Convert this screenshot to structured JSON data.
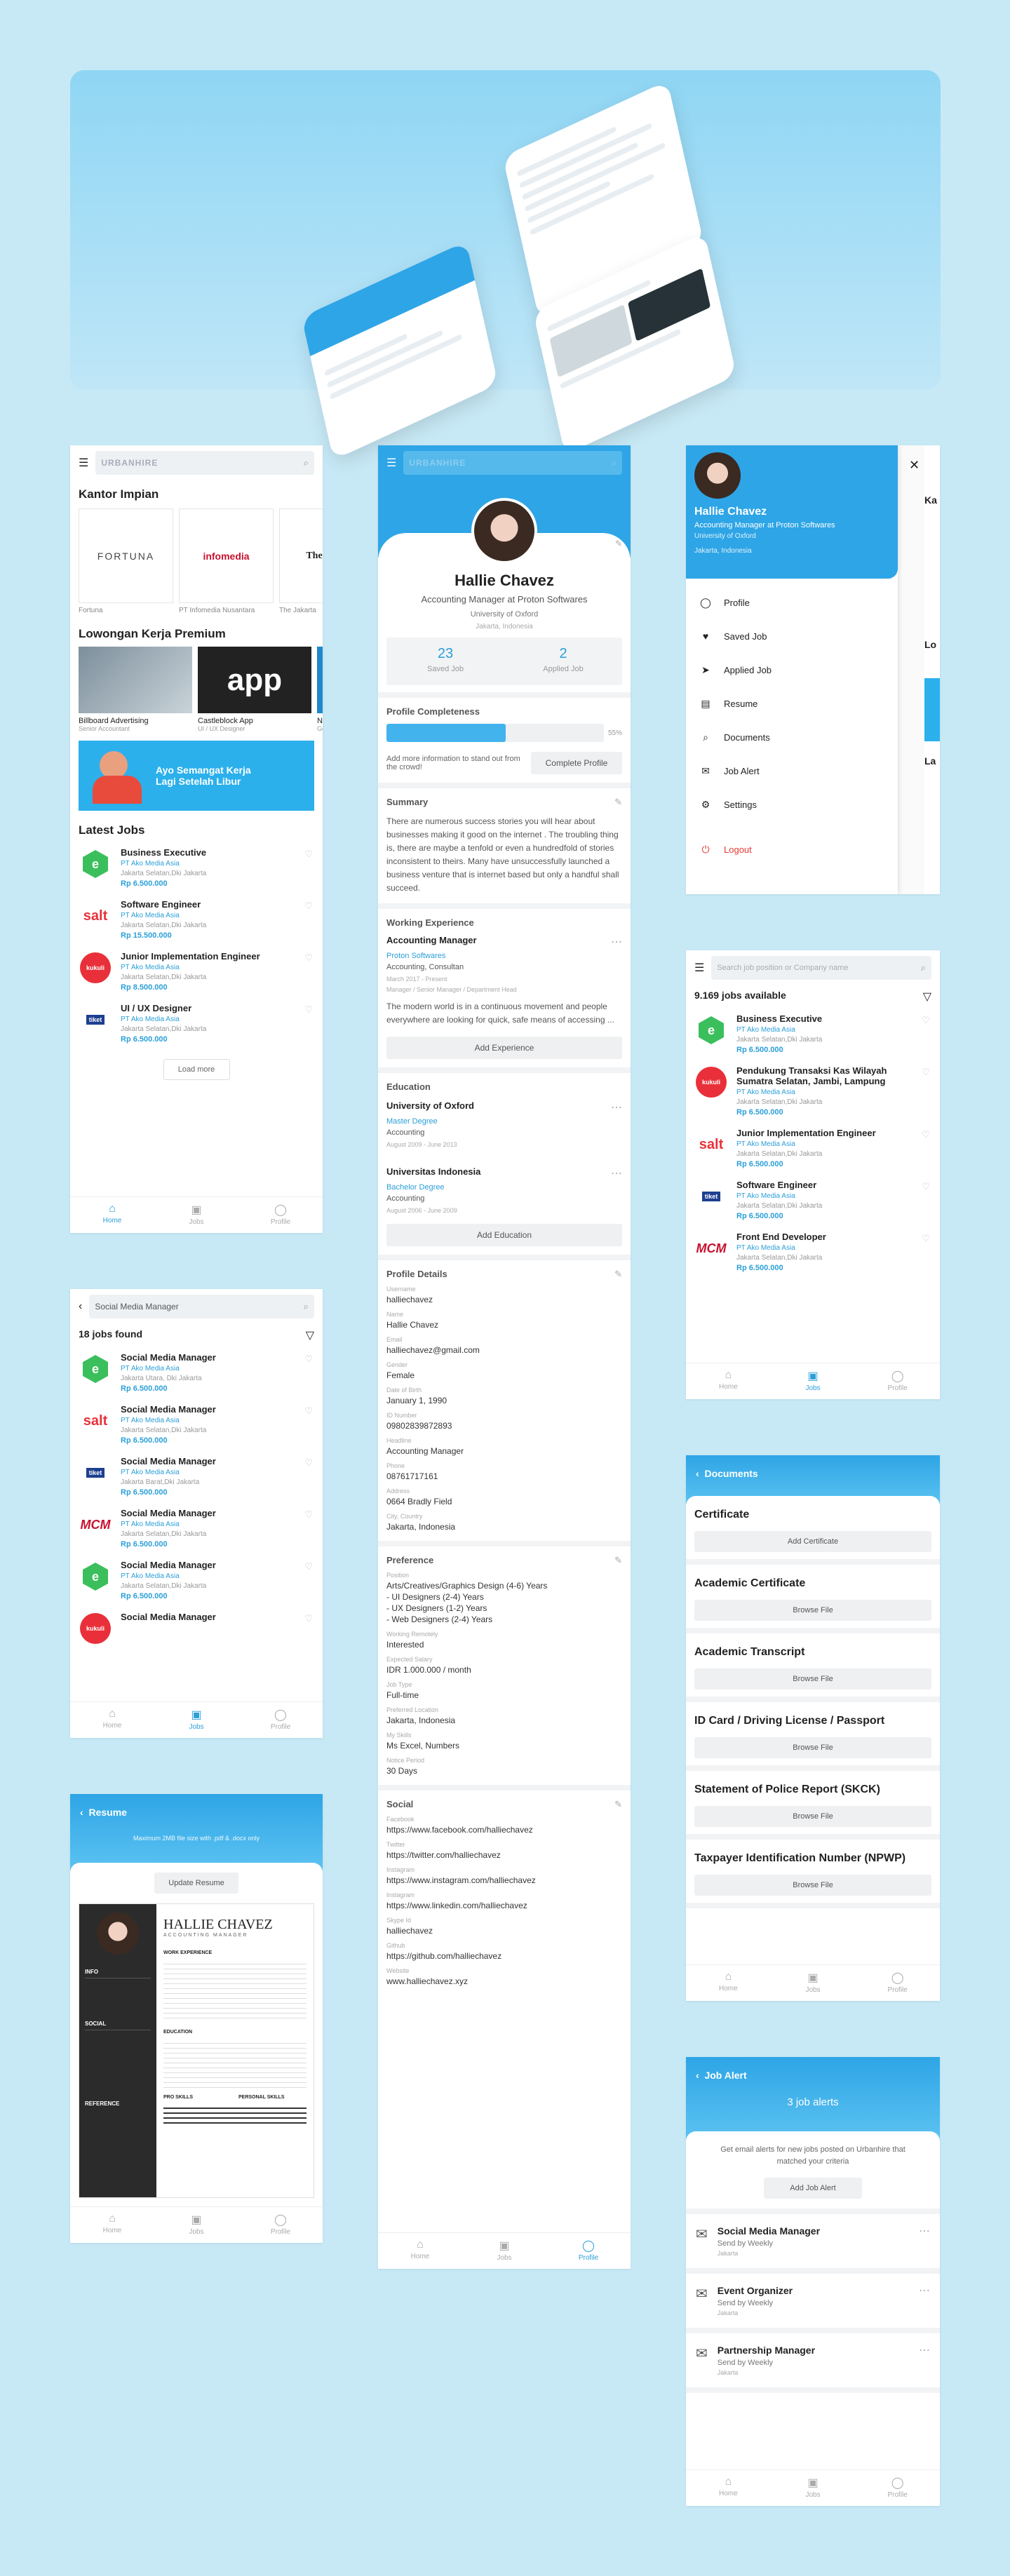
{
  "brand": "URBANHIRE",
  "nav": {
    "home": "Home",
    "jobs": "Jobs",
    "profile": "Profile"
  },
  "home": {
    "section_companies": "Kantor Impian",
    "companies": [
      {
        "name": "Fortuna",
        "logo": "FORTUNA"
      },
      {
        "name": "PT Infomedia Nusantara",
        "logo": "infomedia"
      },
      {
        "name": "The Jakarta",
        "logo": "TheJakar"
      }
    ],
    "section_premium": "Lowongan Kerja Premium",
    "premium": [
      {
        "title": "Billboard Advertising",
        "role": "Senior Accountant"
      },
      {
        "title": "Castleblock App",
        "role": "UI / UX Designer"
      },
      {
        "title": "Na",
        "role": "Ge"
      }
    ],
    "banner_line1": "Ayo Semangat Kerja",
    "banner_line2": "Lagi Setelah Libur",
    "section_latest": "Latest Jobs",
    "jobs": [
      {
        "title": "Business Executive",
        "company": "PT Ako Media Asia",
        "location": "Jakarta Selatan,Dki Jakarta",
        "salary": "Rp 6.500.000",
        "logo": "e",
        "color": "#3bbf5c"
      },
      {
        "title": "Software Engineer",
        "company": "PT Ako Media Asia",
        "location": "Jakarta Selatan,Dki Jakarta",
        "salary": "Rp 15.500.000",
        "logo": "salt",
        "color": "#e9303a"
      },
      {
        "title": "Junior Implementation Engineer",
        "company": "PT Ako Media Asia",
        "location": "Jakarta Selatan,Dki Jakarta",
        "salary": "Rp 8.500.000",
        "logo": "kukuli",
        "color": "#e9303a"
      },
      {
        "title": "UI / UX Designer",
        "company": "PT Ako Media Asia",
        "location": "Jakarta Selatan,Dki Jakarta",
        "salary": "Rp 6.500.000",
        "logo": "tiket",
        "color": "#1d3f8f"
      }
    ],
    "load_more": "Load more"
  },
  "profile": {
    "name": "Hallie Chavez",
    "headline": "Accounting Manager at Proton Softwares",
    "school": "University of Oxford",
    "city": "Jakarta, Indonesia",
    "saved_count": "23",
    "saved_label": "Saved Job",
    "applied_count": "2",
    "applied_label": "Applied Job",
    "completeness_title": "Profile Completeness",
    "completeness_pct": "55%",
    "completeness_value": 55,
    "completeness_hint": "Add more information to stand out from the crowd!",
    "complete_btn": "Complete Profile",
    "summary_title": "Summary",
    "summary_text": "There are numerous success stories you will hear about businesses making it good on the internet . The troubling thing is, there are maybe a tenfold or even a hundredfold of stories inconsistent to theirs. Many have unsuccessfully launched a business venture that is internet based but only a handful shall succeed.",
    "work_title": "Working Experience",
    "work": {
      "role": "Accounting Manager",
      "company": "Proton Softwares",
      "type": "Accounting, Consultan",
      "period": "March 2017 - Present",
      "tags": "Manager / Senior Manager / Department Head",
      "desc": "The modern world is in a continuous movement and people everywhere are looking for quick, safe means of accessing ..."
    },
    "add_experience": "Add Experience",
    "edu_title": "Education",
    "edu": [
      {
        "school": "University of Oxford",
        "degree": "Master Degree",
        "field": "Accounting",
        "period": "August 2009 - June 2013"
      },
      {
        "school": "Universitas Indonesia",
        "degree": "Bachelor Degree",
        "field": "Accounting",
        "period": "August 2006 - June 2009"
      }
    ],
    "add_education": "Add Education",
    "details_title": "Profile Details",
    "details": [
      {
        "k": "Username",
        "v": "halliechavez"
      },
      {
        "k": "Name",
        "v": "Hallie Chavez"
      },
      {
        "k": "Email",
        "v": "halliechavez@gmail.com"
      },
      {
        "k": "Gender",
        "v": "Female"
      },
      {
        "k": "Date of Birth",
        "v": "January 1, 1990"
      },
      {
        "k": "ID Number",
        "v": "09802839872893"
      },
      {
        "k": "Headline",
        "v": "Accounting Manager"
      },
      {
        "k": "Phone",
        "v": "08761717161"
      },
      {
        "k": "Address",
        "v": "0664 Bradly Field"
      },
      {
        "k": "City, Country",
        "v": "Jakarta, Indonesia"
      }
    ],
    "pref_title": "Preference",
    "pref": [
      {
        "k": "Position",
        "v": "Arts/Creatives/Graphics Design (4-6) Years\n- UI Designers (2-4) Years\n- UX Designers (1-2) Years\n- Web Designers (2-4) Years"
      },
      {
        "k": "Working Remotely",
        "v": "Interested"
      },
      {
        "k": "Expected Salary",
        "v": "IDR 1.000.000 / month"
      },
      {
        "k": "Job Type",
        "v": "Full-time"
      },
      {
        "k": "Preferred Location",
        "v": "Jakarta, Indonesia"
      },
      {
        "k": "My Skills",
        "v": "Ms Excel, Numbers"
      },
      {
        "k": "Notice Period",
        "v": "30 Days"
      }
    ],
    "social_title": "Social",
    "social": [
      {
        "k": "Facebook",
        "v": "https://www.facebook.com/halliechavez"
      },
      {
        "k": "Twitter",
        "v": "https://twitter.com/halliechavez"
      },
      {
        "k": "Instagram",
        "v": "https://www.instagram.com/halliechavez"
      },
      {
        "k": "Instagram",
        "v": "https://www.linkedin.com/halliechavez"
      },
      {
        "k": "Skype Id",
        "v": "halliechavez"
      },
      {
        "k": "Github",
        "v": "https://github.com/halliechavez"
      },
      {
        "k": "Website",
        "v": "www.halliechavez.xyz"
      }
    ]
  },
  "drawer": {
    "items": [
      "Profile",
      "Saved Job",
      "Applied Job",
      "Resume",
      "Documents",
      "Job Alert",
      "Settings",
      "Logout"
    ]
  },
  "search": {
    "placeholder": "Search job position or Company name",
    "count": "9.169 jobs available",
    "jobs": [
      {
        "title": "Business Executive",
        "company": "PT Ako Media Asia",
        "location": "Jakarta Selatan,Dki Jakarta",
        "salary": "Rp 6.500.000",
        "logo": "e",
        "color": "#3bbf5c"
      },
      {
        "title": "Pendukung Transaksi Kas Wilayah Sumatra Selatan, Jambi, Lampung",
        "company": "PT Ako Media Asia",
        "location": "Jakarta Selatan,Dki Jakarta",
        "salary": "Rp 6.500.000",
        "logo": "kukuli",
        "color": "#e9303a"
      },
      {
        "title": "Junior Implementation Engineer",
        "company": "PT Ako Media Asia",
        "location": "Jakarta Selatan,Dki Jakarta",
        "salary": "Rp 6.500.000",
        "logo": "salt",
        "color": "#e9303a"
      },
      {
        "title": "Software Engineer",
        "company": "PT Ako Media Asia",
        "location": "Jakarta Selatan,Dki Jakarta",
        "salary": "Rp 6.500.000",
        "logo": "tiket",
        "color": "#1d3f8f"
      },
      {
        "title": "Front End Developer",
        "company": "PT Ako Media Asia",
        "location": "Jakarta Selatan,Dki Jakarta",
        "salary": "Rp 6.500.000",
        "logo": "mcm",
        "color": "#c8102e"
      }
    ]
  },
  "results": {
    "query": "Social Media Manager",
    "count": "18 jobs found",
    "jobs": [
      {
        "title": "Social Media Manager",
        "company": "PT Ako Media Asia",
        "location": "Jakarta Utara, Dki Jakarta",
        "salary": "Rp 6.500.000",
        "logo": "e",
        "color": "#3bbf5c"
      },
      {
        "title": "Social Media Manager",
        "company": "PT Ako Media Asia",
        "location": "Jakarta Selatan,Dki Jakarta",
        "salary": "Rp 6.500.000",
        "logo": "salt",
        "color": "#e9303a"
      },
      {
        "title": "Social Media Manager",
        "company": "PT Ako Media Asia",
        "location": "Jakarta Barat,Dki Jakarta",
        "salary": "Rp 6.500.000",
        "logo": "tiket",
        "color": "#1d3f8f"
      },
      {
        "title": "Social Media Manager",
        "company": "PT Ako Media Asia",
        "location": "Jakarta Selatan,Dki Jakarta",
        "salary": "Rp 6.500.000",
        "logo": "mcm",
        "color": "#c8102e"
      },
      {
        "title": "Social Media Manager",
        "company": "PT Ako Media Asia",
        "location": "Jakarta Selatan,Dki Jakarta",
        "salary": "Rp 6.500.000",
        "logo": "e",
        "color": "#3bbf5c"
      },
      {
        "title": "Social Media Manager",
        "company": "",
        "location": "",
        "salary": "",
        "logo": "kukuli",
        "color": "#e9303a"
      }
    ]
  },
  "documents": {
    "title": "Documents",
    "items": [
      {
        "name": "Certificate",
        "btn": "Add Certificate"
      },
      {
        "name": "Academic Certificate",
        "btn": "Browse File"
      },
      {
        "name": "Academic Transcript",
        "btn": "Browse File"
      },
      {
        "name": "ID Card / Driving License / Passport",
        "btn": "Browse File"
      },
      {
        "name": "Statement of Police Report (SKCK)",
        "btn": "Browse File"
      },
      {
        "name": "Taxpayer Identification Number (NPWP)",
        "btn": "Browse File"
      }
    ]
  },
  "resume": {
    "title": "Resume",
    "hint": "Maximum 2MB file size with .pdf & .docx only",
    "update_btn": "Update Resume",
    "cv_name": "HALLIE CHAVEZ",
    "cv_role": "ACCOUNTING MANAGER",
    "cv_sections": [
      "INFO",
      "SOCIAL",
      "REFERENCE"
    ],
    "cv_main": [
      "WORK EXPERIENCE",
      "EDUCATION",
      "PRO SKILLS",
      "PERSONAL SKILLS"
    ]
  },
  "alert": {
    "title": "Job Alert",
    "count": "3 job alerts",
    "hint": "Get email alerts for new jobs posted on Urbanhire that matched your criteria",
    "add_btn": "Add Job Alert",
    "items": [
      {
        "title": "Social Media Manager",
        "freq": "Send by Weekly",
        "loc": "Jakarta"
      },
      {
        "title": "Event Organizer",
        "freq": "Send by Weekly",
        "loc": "Jakarta"
      },
      {
        "title": "Partnership Manager",
        "freq": "Send by Weekly",
        "loc": "Jakarta"
      }
    ]
  }
}
